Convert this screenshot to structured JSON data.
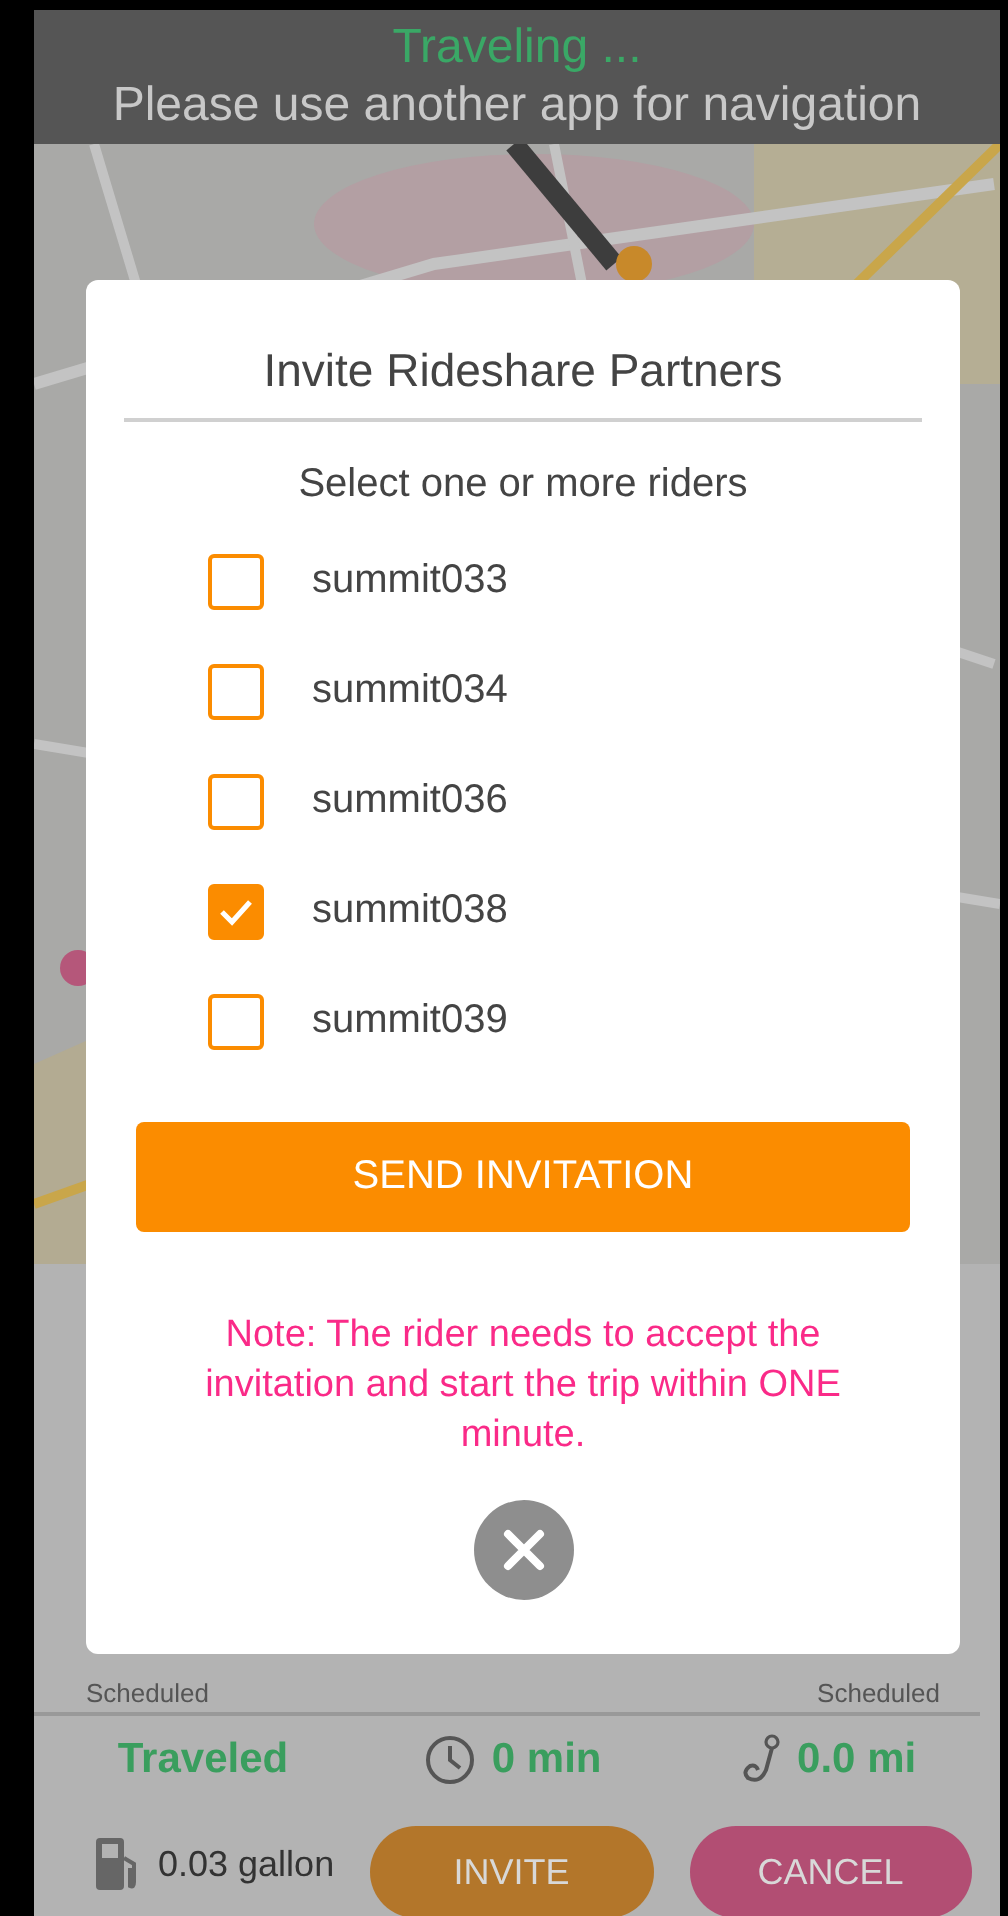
{
  "header": {
    "status": "Traveling ...",
    "message": "Please use another app for navigation"
  },
  "dialog": {
    "title": "Invite Rideshare Partners",
    "prompt": "Select one or more riders",
    "riders": [
      {
        "name": "summit033",
        "checked": false
      },
      {
        "name": "summit034",
        "checked": false
      },
      {
        "name": "summit036",
        "checked": false
      },
      {
        "name": "summit038",
        "checked": true
      },
      {
        "name": "summit039",
        "checked": false
      }
    ],
    "send_button": "SEND INVITATION",
    "note": "Note: The rider needs to accept the invitation and start the trip within ONE minute."
  },
  "trip": {
    "pickup_label": "Scheduled",
    "dropoff_label": "Scheduled",
    "status": "Traveled",
    "duration": "0 min",
    "distance": "0.0 mi",
    "fuel": "0.03 gallon"
  },
  "actions": [
    {
      "label": "INVITE",
      "kind": "invite"
    },
    {
      "label": "CANCEL",
      "kind": "cancel"
    }
  ]
}
